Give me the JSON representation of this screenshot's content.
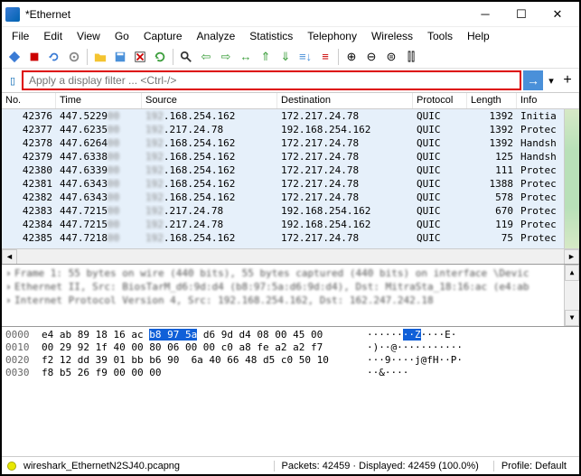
{
  "window": {
    "title": "*Ethernet"
  },
  "menu": [
    "File",
    "Edit",
    "View",
    "Go",
    "Capture",
    "Analyze",
    "Statistics",
    "Telephony",
    "Wireless",
    "Tools",
    "Help"
  ],
  "filter": {
    "placeholder": "Apply a display filter ... <Ctrl-/>"
  },
  "columns": {
    "no": "No.",
    "time": "Time",
    "src": "Source",
    "dst": "Destination",
    "proto": "Protocol",
    "len": "Length",
    "info": "Info"
  },
  "packets": [
    {
      "no": "42376",
      "time": "447.5229",
      "src": ".168.254.162",
      "dst": "172.217.24.78",
      "proto": "QUIC",
      "len": "1392",
      "info": "Initia"
    },
    {
      "no": "42377",
      "time": "447.6235",
      "src": ".217.24.78",
      "dst": "192.168.254.162",
      "proto": "QUIC",
      "len": "1392",
      "info": "Protec"
    },
    {
      "no": "42378",
      "time": "447.6264",
      "src": ".168.254.162",
      "dst": "172.217.24.78",
      "proto": "QUIC",
      "len": "1392",
      "info": "Handsh"
    },
    {
      "no": "42379",
      "time": "447.6338",
      "src": ".168.254.162",
      "dst": "172.217.24.78",
      "proto": "QUIC",
      "len": "125",
      "info": "Handsh"
    },
    {
      "no": "42380",
      "time": "447.6339",
      "src": ".168.254.162",
      "dst": "172.217.24.78",
      "proto": "QUIC",
      "len": "111",
      "info": "Protec"
    },
    {
      "no": "42381",
      "time": "447.6343",
      "src": ".168.254.162",
      "dst": "172.217.24.78",
      "proto": "QUIC",
      "len": "1388",
      "info": "Protec"
    },
    {
      "no": "42382",
      "time": "447.6343",
      "src": ".168.254.162",
      "dst": "172.217.24.78",
      "proto": "QUIC",
      "len": "578",
      "info": "Protec"
    },
    {
      "no": "42383",
      "time": "447.7215",
      "src": ".217.24.78",
      "dst": "192.168.254.162",
      "proto": "QUIC",
      "len": "670",
      "info": "Protec"
    },
    {
      "no": "42384",
      "time": "447.7215",
      "src": ".217.24.78",
      "dst": "192.168.254.162",
      "proto": "QUIC",
      "len": "119",
      "info": "Protec"
    },
    {
      "no": "42385",
      "time": "447.7218",
      "src": ".168.254.162",
      "dst": "172.217.24.78",
      "proto": "QUIC",
      "len": "75",
      "info": "Protec"
    }
  ],
  "details": [
    "Frame 1: 55 bytes on wire (440 bits), 55 bytes captured (440 bits) on interface \\Devic",
    "Ethernet II, Src: BiosTarM_d6:9d:d4 (b8:97:5a:d6:9d:d4), Dst: MitraSta_18:16:ac (e4:ab",
    "Internet Protocol Version 4, Src: 192.168.254.162, Dst: 162.247.242.18"
  ],
  "hex": [
    {
      "off": "0000",
      "b1": "e4 ab 89 18 16 ac ",
      "bh": "b8 97 5a",
      "b2": " d6 9d d4 08 00 45 00",
      "asc": "······",
      "ash": "··Z",
      "asc2": "····E·"
    },
    {
      "off": "0010",
      "b1": "00 29 92 1f 40 00 80 06 00 00 c0 a8 fe a2 a2 f7",
      "bh": "",
      "b2": "",
      "asc": "·)··@···········",
      "ash": "",
      "asc2": ""
    },
    {
      "off": "0020",
      "b1": "f2 12 dd 39 01 bb b6 90  6a 40 66 48 d5 c0 50 10",
      "bh": "",
      "b2": "",
      "asc": "···9····j@fH··P·",
      "ash": "",
      "asc2": ""
    },
    {
      "off": "0030",
      "b1": "f8 b5 26 f9 00 00 00",
      "bh": "",
      "b2": "",
      "asc": "··&····",
      "ash": "",
      "asc2": ""
    }
  ],
  "status": {
    "file": "wireshark_EthernetN2SJ40.pcapng",
    "packets": "Packets: 42459 · Displayed: 42459 (100.0%)",
    "profile": "Profile: Default"
  }
}
